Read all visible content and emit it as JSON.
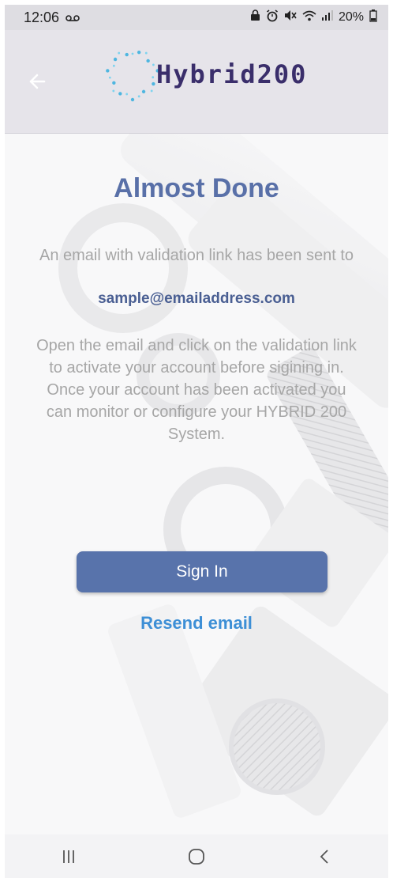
{
  "status_bar": {
    "time": "12:06",
    "voicemail_icon": "voicemail-icon",
    "battery": "20%"
  },
  "header": {
    "logo_text": "Hybrid200",
    "back_icon": "arrow-left-icon"
  },
  "main": {
    "title": "Almost Done",
    "message": "An email with validation link has been sent to",
    "email": "sample@emailaddress.com",
    "instructions": "Open the email and click on the validation link to activate your account before sigining in.\nOnce your account has been activated you can monitor or configure your HYBRID 200 System.",
    "signin_label": "Sign In",
    "resend_label": "Resend email"
  },
  "nav_bar": {
    "recents_icon": "recent-apps-icon",
    "home_icon": "home-icon",
    "back_icon": "back-chevron-icon"
  },
  "colors": {
    "title": "#5970a8",
    "button": "#5873ab",
    "link": "#3d8fd6",
    "header_bg": "#e6e4ea"
  }
}
